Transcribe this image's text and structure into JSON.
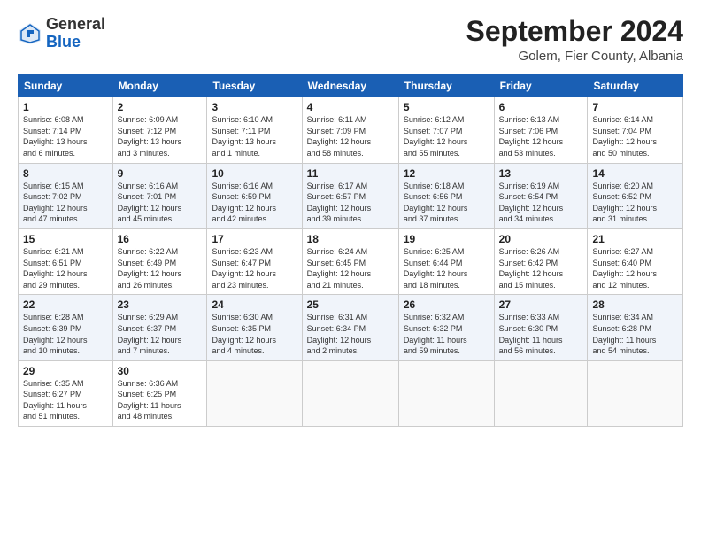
{
  "logo": {
    "general": "General",
    "blue": "Blue"
  },
  "title": "September 2024",
  "subtitle": "Golem, Fier County, Albania",
  "days_header": [
    "Sunday",
    "Monday",
    "Tuesday",
    "Wednesday",
    "Thursday",
    "Friday",
    "Saturday"
  ],
  "weeks": [
    [
      {
        "day": "1",
        "info": "Sunrise: 6:08 AM\nSunset: 7:14 PM\nDaylight: 13 hours\nand 6 minutes."
      },
      {
        "day": "2",
        "info": "Sunrise: 6:09 AM\nSunset: 7:12 PM\nDaylight: 13 hours\nand 3 minutes."
      },
      {
        "day": "3",
        "info": "Sunrise: 6:10 AM\nSunset: 7:11 PM\nDaylight: 13 hours\nand 1 minute."
      },
      {
        "day": "4",
        "info": "Sunrise: 6:11 AM\nSunset: 7:09 PM\nDaylight: 12 hours\nand 58 minutes."
      },
      {
        "day": "5",
        "info": "Sunrise: 6:12 AM\nSunset: 7:07 PM\nDaylight: 12 hours\nand 55 minutes."
      },
      {
        "day": "6",
        "info": "Sunrise: 6:13 AM\nSunset: 7:06 PM\nDaylight: 12 hours\nand 53 minutes."
      },
      {
        "day": "7",
        "info": "Sunrise: 6:14 AM\nSunset: 7:04 PM\nDaylight: 12 hours\nand 50 minutes."
      }
    ],
    [
      {
        "day": "8",
        "info": "Sunrise: 6:15 AM\nSunset: 7:02 PM\nDaylight: 12 hours\nand 47 minutes."
      },
      {
        "day": "9",
        "info": "Sunrise: 6:16 AM\nSunset: 7:01 PM\nDaylight: 12 hours\nand 45 minutes."
      },
      {
        "day": "10",
        "info": "Sunrise: 6:16 AM\nSunset: 6:59 PM\nDaylight: 12 hours\nand 42 minutes."
      },
      {
        "day": "11",
        "info": "Sunrise: 6:17 AM\nSunset: 6:57 PM\nDaylight: 12 hours\nand 39 minutes."
      },
      {
        "day": "12",
        "info": "Sunrise: 6:18 AM\nSunset: 6:56 PM\nDaylight: 12 hours\nand 37 minutes."
      },
      {
        "day": "13",
        "info": "Sunrise: 6:19 AM\nSunset: 6:54 PM\nDaylight: 12 hours\nand 34 minutes."
      },
      {
        "day": "14",
        "info": "Sunrise: 6:20 AM\nSunset: 6:52 PM\nDaylight: 12 hours\nand 31 minutes."
      }
    ],
    [
      {
        "day": "15",
        "info": "Sunrise: 6:21 AM\nSunset: 6:51 PM\nDaylight: 12 hours\nand 29 minutes."
      },
      {
        "day": "16",
        "info": "Sunrise: 6:22 AM\nSunset: 6:49 PM\nDaylight: 12 hours\nand 26 minutes."
      },
      {
        "day": "17",
        "info": "Sunrise: 6:23 AM\nSunset: 6:47 PM\nDaylight: 12 hours\nand 23 minutes."
      },
      {
        "day": "18",
        "info": "Sunrise: 6:24 AM\nSunset: 6:45 PM\nDaylight: 12 hours\nand 21 minutes."
      },
      {
        "day": "19",
        "info": "Sunrise: 6:25 AM\nSunset: 6:44 PM\nDaylight: 12 hours\nand 18 minutes."
      },
      {
        "day": "20",
        "info": "Sunrise: 6:26 AM\nSunset: 6:42 PM\nDaylight: 12 hours\nand 15 minutes."
      },
      {
        "day": "21",
        "info": "Sunrise: 6:27 AM\nSunset: 6:40 PM\nDaylight: 12 hours\nand 12 minutes."
      }
    ],
    [
      {
        "day": "22",
        "info": "Sunrise: 6:28 AM\nSunset: 6:39 PM\nDaylight: 12 hours\nand 10 minutes."
      },
      {
        "day": "23",
        "info": "Sunrise: 6:29 AM\nSunset: 6:37 PM\nDaylight: 12 hours\nand 7 minutes."
      },
      {
        "day": "24",
        "info": "Sunrise: 6:30 AM\nSunset: 6:35 PM\nDaylight: 12 hours\nand 4 minutes."
      },
      {
        "day": "25",
        "info": "Sunrise: 6:31 AM\nSunset: 6:34 PM\nDaylight: 12 hours\nand 2 minutes."
      },
      {
        "day": "26",
        "info": "Sunrise: 6:32 AM\nSunset: 6:32 PM\nDaylight: 11 hours\nand 59 minutes."
      },
      {
        "day": "27",
        "info": "Sunrise: 6:33 AM\nSunset: 6:30 PM\nDaylight: 11 hours\nand 56 minutes."
      },
      {
        "day": "28",
        "info": "Sunrise: 6:34 AM\nSunset: 6:28 PM\nDaylight: 11 hours\nand 54 minutes."
      }
    ],
    [
      {
        "day": "29",
        "info": "Sunrise: 6:35 AM\nSunset: 6:27 PM\nDaylight: 11 hours\nand 51 minutes."
      },
      {
        "day": "30",
        "info": "Sunrise: 6:36 AM\nSunset: 6:25 PM\nDaylight: 11 hours\nand 48 minutes."
      },
      null,
      null,
      null,
      null,
      null
    ]
  ]
}
